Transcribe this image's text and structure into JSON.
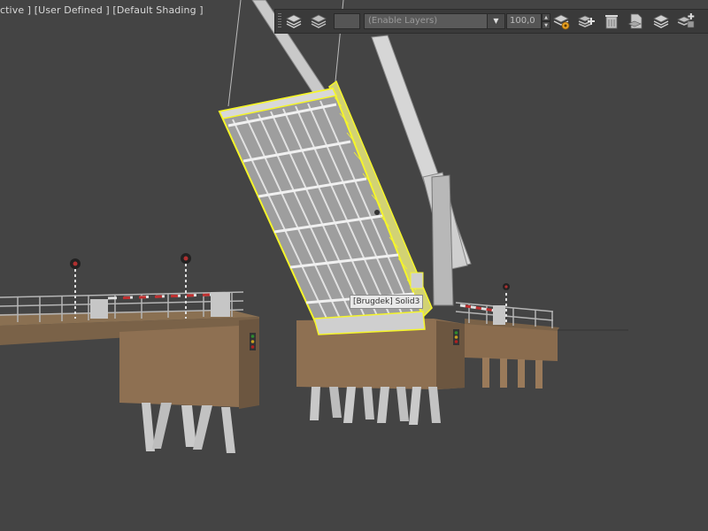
{
  "viewport": {
    "label_parts": [
      "ctive ]",
      " [User Defined ]",
      " [Default Shading ]"
    ],
    "background": "#444444",
    "selection_color": "#f5f52a"
  },
  "layer_toolbar": {
    "dropdown_value": "(Enable Layers)",
    "opacity_value": "100,0",
    "buttons": [
      {
        "name": "manage-layers-icon"
      },
      {
        "name": "layer-properties-icon"
      },
      {
        "name": "layer-settings-icon"
      },
      {
        "name": "new-layer-icon"
      },
      {
        "name": "delete-layer-icon"
      },
      {
        "name": "layer-file-icon"
      },
      {
        "name": "layer-stack-icon"
      },
      {
        "name": "add-layer-icon"
      }
    ]
  },
  "tooltip": {
    "text": "[Brugdek] Solid3"
  }
}
